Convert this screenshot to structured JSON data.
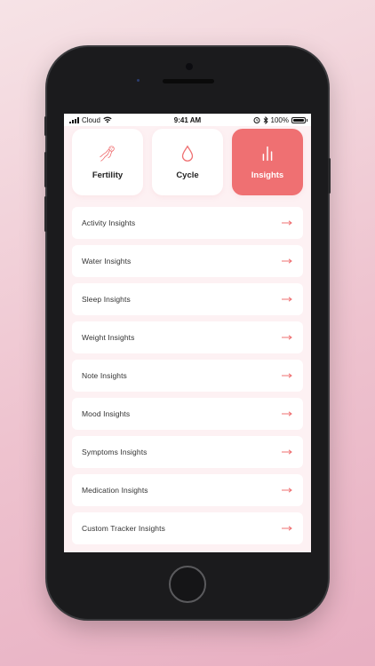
{
  "status_bar": {
    "carrier": "Cloud",
    "time": "9:41 AM",
    "battery": "100%",
    "icons": [
      "signal-icon",
      "wifi-icon",
      "alarm-icon",
      "bluetooth-icon",
      "battery-icon"
    ]
  },
  "tabs": [
    {
      "label": "Fertility",
      "icon": "sperm-icon",
      "active": false
    },
    {
      "label": "Cycle",
      "icon": "drop-icon",
      "active": false
    },
    {
      "label": "Insights",
      "icon": "bar-chart-icon",
      "active": true
    }
  ],
  "insights": [
    {
      "label": "Activity Insights"
    },
    {
      "label": "Water Insights"
    },
    {
      "label": "Sleep Insights"
    },
    {
      "label": "Weight Insights"
    },
    {
      "label": "Note Insights"
    },
    {
      "label": "Mood Insights"
    },
    {
      "label": "Symptoms Insights"
    },
    {
      "label": "Medication Insights"
    },
    {
      "label": "Custom Tracker Insights"
    }
  ],
  "colors": {
    "accent": "#ef7072",
    "row_background": "#ffffff",
    "screen_background": "#fdf1f3"
  }
}
